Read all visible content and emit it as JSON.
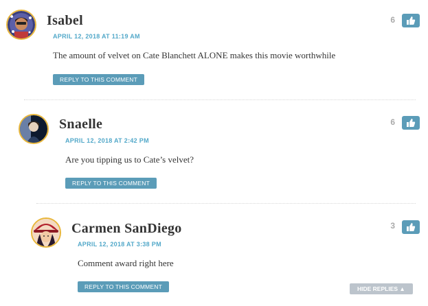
{
  "comments": [
    {
      "author": "Isabel",
      "date": "APRIL 12, 2018 AT 11:19 AM",
      "text": "The amount of velvet on Cate Blanchett ALONE makes this movie worthwhile",
      "reply_label": "REPLY TO THIS COMMENT",
      "votes": "6"
    },
    {
      "author": "Snaelle",
      "date": "APRIL 12, 2018 AT 2:42 PM",
      "text": "Are you tipping us to Cate’s velvet?",
      "reply_label": "REPLY TO THIS COMMENT",
      "votes": "6"
    },
    {
      "author": "Carmen SanDiego",
      "date": "APRIL 12, 2018 AT 3:38 PM",
      "text": "Comment award right here",
      "reply_label": "REPLY TO THIS COMMENT",
      "votes": "3"
    }
  ],
  "hide_replies_label": "HIDE REPLIES ▲",
  "colors": {
    "accent": "#5b9cb8",
    "date": "#52a8c9",
    "avatar_ring": "#e8b63a",
    "hide_button": "#bcc4cc"
  },
  "icons": {
    "like": "thumbs-up-icon"
  }
}
